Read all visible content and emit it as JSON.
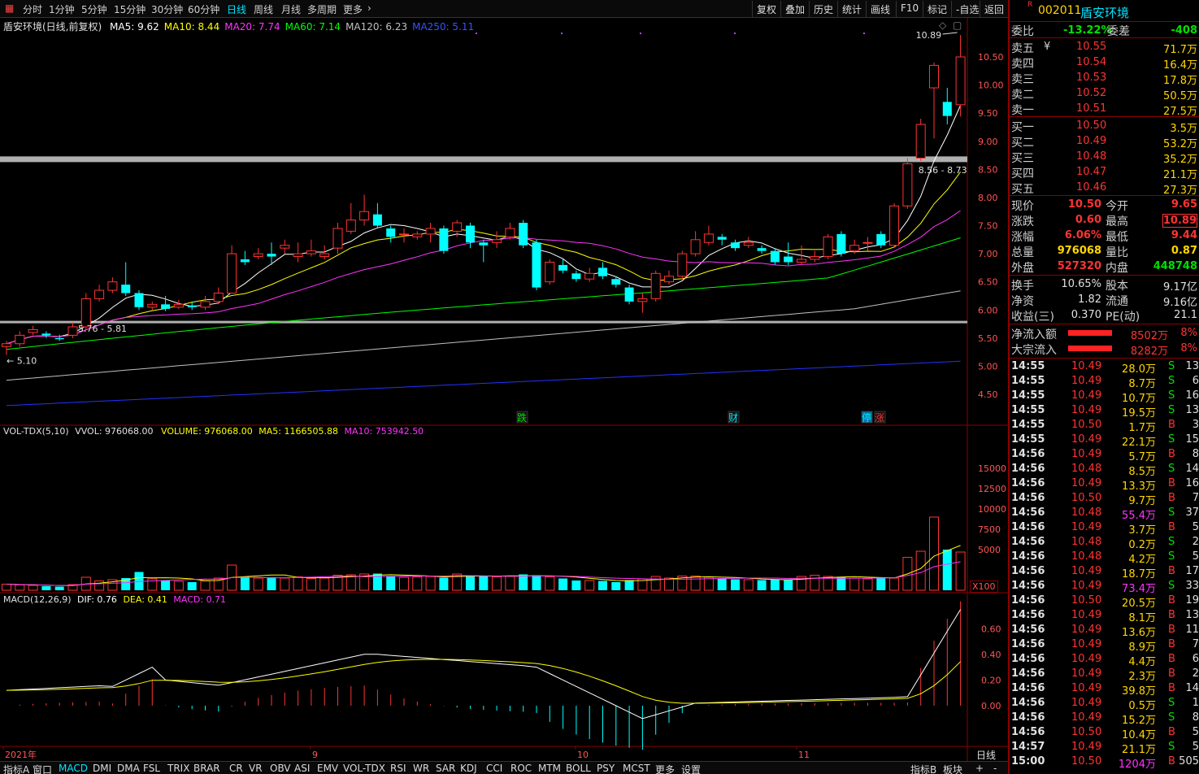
{
  "toolbar": {
    "periods": [
      "分时",
      "1分钟",
      "5分钟",
      "15分钟",
      "30分钟",
      "60分钟",
      "日线",
      "周线",
      "月线",
      "多周期",
      "更多"
    ],
    "active_period": "日线",
    "right_buttons": [
      "复权",
      "叠加",
      "历史",
      "统计",
      "画线",
      "F10",
      "标记",
      "-自选",
      "返回"
    ]
  },
  "chart_header": {
    "name": "盾安环境(日线,前复权)",
    "ma": [
      {
        "label": "MA5: 9.62",
        "color": "#ffffff"
      },
      {
        "label": "MA10: 8.44",
        "color": "#ffff00"
      },
      {
        "label": "MA20: 7.74",
        "color": "#ff33ff"
      },
      {
        "label": "MA60: 7.14",
        "color": "#00ff00"
      },
      {
        "label": "MA120: 6.23",
        "color": "#c0c0c0"
      },
      {
        "label": "MA250: 5.11",
        "color": "#3355ff"
      }
    ]
  },
  "price_annotations": {
    "high": "10.89",
    "zone_high": "8.56 - 8.73",
    "zone_low": "5.76 - 5.81",
    "low": "5.10"
  },
  "event_tags": [
    {
      "text": "跌",
      "color": "#00e000"
    },
    {
      "text": "财",
      "color": "#00e5ff"
    },
    {
      "text": "停",
      "color": "#00e5ff"
    },
    {
      "text": "涨",
      "color": "#ff3333"
    }
  ],
  "price_axis": [
    "10.50",
    "10.00",
    "9.50",
    "9.00",
    "8.50",
    "8.00",
    "7.50",
    "7.00",
    "6.50",
    "6.00",
    "5.50",
    "5.00",
    "4.50"
  ],
  "volume_header": {
    "name": "VOL-TDX(5,10)",
    "vvol": "VVOL: 976068.00",
    "volume": "VOLUME: 976068.00",
    "ma5": "MA5: 1166505.88",
    "ma10": "MA10: 753942.50"
  },
  "volume_axis": [
    "15000",
    "12500",
    "10000",
    "7500",
    "5000"
  ],
  "volume_unit": "X100",
  "macd_header": {
    "name": "MACD(12,26,9)",
    "dif": "DIF: 0.76",
    "dea": "DEA: 0.41",
    "macd": "MACD: 0.71"
  },
  "macd_axis": [
    "0.60",
    "0.40",
    "0.20",
    "0.00"
  ],
  "date_axis": [
    "2021年",
    "9",
    "10",
    "11"
  ],
  "date_mode": "日线",
  "bottom_tabs": [
    "指标A",
    "窗口",
    "MACD",
    "DMI",
    "DMA",
    "FSL",
    "TRIX",
    "BRAR",
    "CR",
    "VR",
    "OBV",
    "ASI",
    "EMV",
    "VOL-TDX",
    "RSI",
    "WR",
    "SAR",
    "KDJ",
    "CCI",
    "ROC",
    "MTM",
    "BOLL",
    "PSY",
    "MCST",
    "更多",
    "设置"
  ],
  "bottom_right": [
    "指标B",
    "板块",
    "+",
    "-"
  ],
  "active_tab": "MACD",
  "quote": {
    "code": "002011",
    "name": "盾安环境",
    "weibi_label": "委比",
    "weibi": "-13.22%",
    "weicha_label": "委差",
    "weicha": "-408",
    "asks": [
      {
        "label": "卖五",
        "price": "10.55",
        "vol": "71.7万"
      },
      {
        "label": "卖四",
        "price": "10.54",
        "vol": "16.4万"
      },
      {
        "label": "卖三",
        "price": "10.53",
        "vol": "17.8万"
      },
      {
        "label": "卖二",
        "price": "10.52",
        "vol": "50.5万"
      },
      {
        "label": "卖一",
        "price": "10.51",
        "vol": "27.5万"
      }
    ],
    "ask_extra": "¥",
    "bids": [
      {
        "label": "买一",
        "price": "10.50",
        "vol": "3.5万"
      },
      {
        "label": "买二",
        "price": "10.49",
        "vol": "53.2万"
      },
      {
        "label": "买三",
        "price": "10.48",
        "vol": "35.2万"
      },
      {
        "label": "买四",
        "price": "10.47",
        "vol": "21.1万"
      },
      {
        "label": "买五",
        "price": "10.46",
        "vol": "27.3万"
      }
    ],
    "stats": [
      {
        "l1": "现价",
        "v1": "10.50",
        "c1": "red",
        "l2": "今开",
        "v2": "9.65",
        "c2": "red"
      },
      {
        "l1": "涨跌",
        "v1": "0.60",
        "c1": "red",
        "l2": "最高",
        "v2": "10.89",
        "c2": "red"
      },
      {
        "l1": "涨幅",
        "v1": "6.06%",
        "c1": "red",
        "l2": "最低",
        "v2": "9.44",
        "c2": "red"
      },
      {
        "l1": "总量",
        "v1": "976068",
        "c1": "yel",
        "l2": "量比",
        "v2": "0.87",
        "c2": "yel"
      },
      {
        "l1": "外盘",
        "v1": "527320",
        "c1": "red",
        "l2": "内盘",
        "v2": "448748",
        "c2": "grn"
      }
    ],
    "stats2": [
      {
        "l1": "换手",
        "v1": "10.65%",
        "l2": "股本",
        "v2": "9.17亿"
      },
      {
        "l1": "净资",
        "v1": "1.82",
        "l2": "流通",
        "v2": "9.16亿"
      },
      {
        "l1": "收益(三)",
        "v1": "0.370",
        "l2": "PE(动)",
        "v2": "21.1"
      }
    ],
    "flows": [
      {
        "label": "净流入额",
        "value": "8502万",
        "pct": "8%"
      },
      {
        "label": "大宗流入",
        "value": "8282万",
        "pct": "8%"
      }
    ]
  },
  "ticks": [
    {
      "t": "14:55",
      "p": "10.49",
      "v": "28.0万",
      "s": "S",
      "n": "13"
    },
    {
      "t": "14:55",
      "p": "10.49",
      "v": "8.7万",
      "s": "S",
      "n": "6"
    },
    {
      "t": "14:55",
      "p": "10.49",
      "v": "10.7万",
      "s": "S",
      "n": "16"
    },
    {
      "t": "14:55",
      "p": "10.49",
      "v": "19.5万",
      "s": "S",
      "n": "13"
    },
    {
      "t": "14:55",
      "p": "10.50",
      "v": "1.7万",
      "s": "B",
      "n": "3"
    },
    {
      "t": "14:55",
      "p": "10.49",
      "v": "22.1万",
      "s": "S",
      "n": "15"
    },
    {
      "t": "14:56",
      "p": "10.49",
      "v": "5.7万",
      "s": "B",
      "n": "8"
    },
    {
      "t": "14:56",
      "p": "10.48",
      "v": "8.5万",
      "s": "S",
      "n": "14"
    },
    {
      "t": "14:56",
      "p": "10.49",
      "v": "13.3万",
      "s": "B",
      "n": "16"
    },
    {
      "t": "14:56",
      "p": "10.50",
      "v": "9.7万",
      "s": "B",
      "n": "7"
    },
    {
      "t": "14:56",
      "p": "10.48",
      "v": "55.4万",
      "s": "S",
      "n": "37"
    },
    {
      "t": "14:56",
      "p": "10.49",
      "v": "3.7万",
      "s": "B",
      "n": "5"
    },
    {
      "t": "14:56",
      "p": "10.48",
      "v": "0.2万",
      "s": "S",
      "n": "2"
    },
    {
      "t": "14:56",
      "p": "10.48",
      "v": "4.2万",
      "s": "S",
      "n": "5"
    },
    {
      "t": "14:56",
      "p": "10.49",
      "v": "18.7万",
      "s": "B",
      "n": "17"
    },
    {
      "t": "14:56",
      "p": "10.49",
      "v": "73.4万",
      "s": "S",
      "n": "33"
    },
    {
      "t": "14:56",
      "p": "10.50",
      "v": "20.5万",
      "s": "B",
      "n": "19"
    },
    {
      "t": "14:56",
      "p": "10.49",
      "v": "8.1万",
      "s": "B",
      "n": "13"
    },
    {
      "t": "14:56",
      "p": "10.49",
      "v": "13.6万",
      "s": "B",
      "n": "11"
    },
    {
      "t": "14:56",
      "p": "10.49",
      "v": "8.9万",
      "s": "B",
      "n": "7"
    },
    {
      "t": "14:56",
      "p": "10.49",
      "v": "4.4万",
      "s": "B",
      "n": "6"
    },
    {
      "t": "14:56",
      "p": "10.49",
      "v": "2.3万",
      "s": "B",
      "n": "2"
    },
    {
      "t": "14:56",
      "p": "10.49",
      "v": "39.8万",
      "s": "B",
      "n": "14"
    },
    {
      "t": "14:56",
      "p": "10.49",
      "v": "0.5万",
      "s": "S",
      "n": "1"
    },
    {
      "t": "14:56",
      "p": "10.49",
      "v": "15.2万",
      "s": "S",
      "n": "8"
    },
    {
      "t": "14:56",
      "p": "10.50",
      "v": "10.4万",
      "s": "B",
      "n": "5"
    },
    {
      "t": "14:57",
      "p": "10.49",
      "v": "21.1万",
      "s": "S",
      "n": "5"
    },
    {
      "t": "15:00",
      "p": "10.50",
      "v": "1204万",
      "s": "B",
      "n": "505"
    }
  ]
}
